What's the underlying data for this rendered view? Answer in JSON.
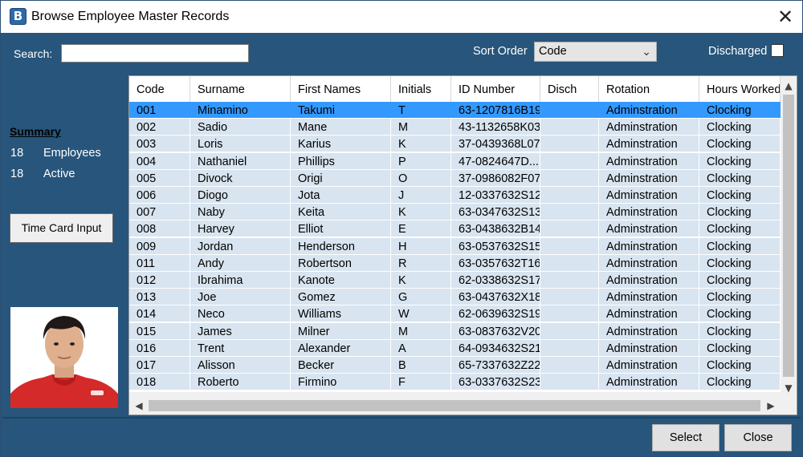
{
  "window": {
    "title": "Browse Employee Master Records",
    "close_glyph": "✕"
  },
  "toolbar": {
    "search_label": "Search:",
    "search_value": "",
    "sort_label": "Sort Order",
    "sort_value": "Code",
    "discharged_label": "Discharged",
    "discharged_checked": false
  },
  "summary": {
    "title": "Summary",
    "employees_count": "18",
    "employees_label": "Employees",
    "active_count": "18",
    "active_label": "Active"
  },
  "buttons": {
    "time_card": "Time Card Input",
    "select": "Select",
    "close": "Close"
  },
  "grid": {
    "columns": [
      "Code",
      "Surname",
      "First Names",
      "Initials",
      "ID Number",
      "Disch",
      "Rotation",
      "Hours Worked"
    ],
    "selected_row": 0,
    "rows": [
      [
        "001",
        "Minamino",
        "Takumi",
        "T",
        "63-1207816B19",
        "",
        "Adminstration",
        "Clocking"
      ],
      [
        "002",
        "Sadio",
        "Mane",
        "M",
        "43-1132658K03",
        "",
        "Adminstration",
        "Clocking"
      ],
      [
        "003",
        "Loris",
        "Karius",
        "K",
        "37-0439368L07",
        "",
        "Adminstration",
        "Clocking"
      ],
      [
        "004",
        "Nathaniel",
        "Phillips",
        "P",
        "47-0824647D...",
        "",
        "Adminstration",
        "Clocking"
      ],
      [
        "005",
        "Divock",
        "Origi",
        "O",
        "37-0986082F07",
        "",
        "Adminstration",
        "Clocking"
      ],
      [
        "006",
        "Diogo",
        "Jota",
        "J",
        "12-0337632S12",
        "",
        "Adminstration",
        "Clocking"
      ],
      [
        "007",
        "Naby",
        "Keita",
        "K",
        "63-0347632S13",
        "",
        "Adminstration",
        "Clocking"
      ],
      [
        "008",
        "Harvey",
        "Elliot",
        "E",
        "63-0438632B14",
        "",
        "Adminstration",
        "Clocking"
      ],
      [
        "009",
        "Jordan",
        "Henderson",
        "H",
        "63-0537632S15",
        "",
        "Adminstration",
        "Clocking"
      ],
      [
        "011",
        "Andy",
        "Robertson",
        "R",
        "63-0357632T16",
        "",
        "Adminstration",
        "Clocking"
      ],
      [
        "012",
        "Ibrahima",
        "Kanote",
        "K",
        "62-0338632S17",
        "",
        "Adminstration",
        "Clocking"
      ],
      [
        "013",
        "Joe",
        "Gomez",
        "G",
        "63-0437632X18",
        "",
        "Adminstration",
        "Clocking"
      ],
      [
        "014",
        "Neco",
        "Williams",
        "W",
        "62-0639632S19",
        "",
        "Adminstration",
        "Clocking"
      ],
      [
        "015",
        "James",
        "Milner",
        "M",
        "63-0837632V20",
        "",
        "Adminstration",
        "Clocking"
      ],
      [
        "016",
        "Trent",
        "Alexander",
        "A",
        "64-0934632S21",
        "",
        "Adminstration",
        "Clocking"
      ],
      [
        "017",
        "Alisson",
        "Becker",
        "B",
        "65-7337632Z22",
        "",
        "Adminstration",
        "Clocking"
      ],
      [
        "018",
        "Roberto",
        "Firmino",
        "F",
        "63-0337632S23",
        "",
        "Adminstration",
        "Clocking"
      ]
    ]
  },
  "colors": {
    "panel": "#27557b",
    "selected_row": "#3399ff",
    "row": "#d8e4ef"
  },
  "icons": {
    "app": "app-logo-icon",
    "close": "close-icon",
    "dropdown": "chevron-down-icon"
  }
}
